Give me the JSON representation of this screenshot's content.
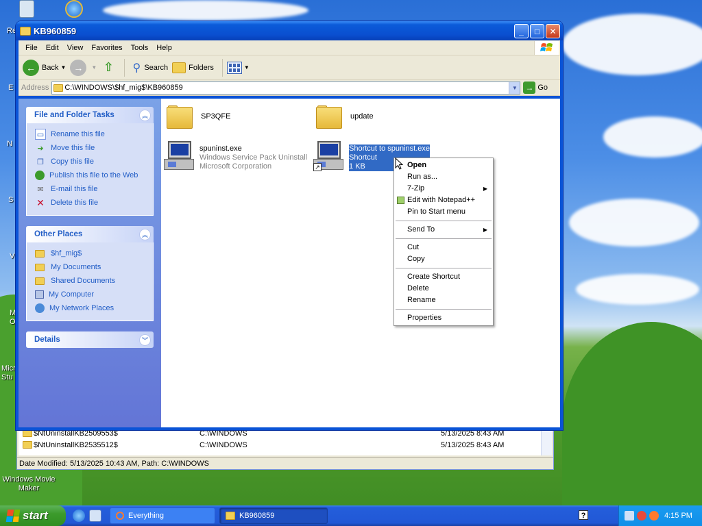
{
  "desktop": {
    "icons": [
      {
        "name": "recycle-bin-icon"
      },
      {
        "name": "internet-explorer-icon"
      }
    ],
    "fragments": [
      "Re",
      "E",
      "N",
      "S",
      "V",
      "M\nO",
      "Micro\nStu"
    ],
    "movie_maker_label": "Windows Movie Maker"
  },
  "window": {
    "title": "KB960859",
    "menu": [
      "File",
      "Edit",
      "View",
      "Favorites",
      "Tools",
      "Help"
    ],
    "toolbar": {
      "back": "Back",
      "search": "Search",
      "folders": "Folders"
    },
    "address": {
      "label": "Address",
      "value": "C:\\WINDOWS\\$hf_mig$\\KB960859",
      "go": "Go"
    },
    "tasks": {
      "file_folder": {
        "title": "File and Folder Tasks",
        "items": [
          "Rename this file",
          "Move this file",
          "Copy this file",
          "Publish this file to the Web",
          "E-mail this file",
          "Delete this file"
        ]
      },
      "other_places": {
        "title": "Other Places",
        "items": [
          "$hf_mig$",
          "My Documents",
          "Shared Documents",
          "My Computer",
          "My Network Places"
        ]
      },
      "details": {
        "title": "Details"
      }
    },
    "files": [
      {
        "name": "SP3QFE",
        "type": "folder"
      },
      {
        "name": "update",
        "type": "folder"
      },
      {
        "name": "spuninst.exe",
        "line2": "Windows Service Pack Uninstall",
        "line3": "Microsoft Corporation"
      },
      {
        "name": "Shortcut to spuninst.exe",
        "line2": "Shortcut",
        "line3": "1 KB"
      }
    ]
  },
  "context_menu": {
    "groups": [
      [
        {
          "label": "Open",
          "bold": true
        },
        {
          "label": "Run as..."
        },
        {
          "label": "7-Zip",
          "submenu": true
        },
        {
          "label": "Edit with Notepad++",
          "icon": "notepad-plus-plus-icon"
        },
        {
          "label": "Pin to Start menu"
        }
      ],
      [
        {
          "label": "Send To",
          "submenu": true
        }
      ],
      [
        {
          "label": "Cut"
        },
        {
          "label": "Copy"
        }
      ],
      [
        {
          "label": "Create Shortcut"
        },
        {
          "label": "Delete"
        },
        {
          "label": "Rename"
        }
      ],
      [
        {
          "label": "Properties"
        }
      ]
    ]
  },
  "background_window": {
    "rows": [
      {
        "name": "$NtUninstallKB2509553$",
        "path": "C:\\WINDOWS",
        "date": "5/13/2025 8:43 AM"
      },
      {
        "name": "$NtUninstallKB2535512$",
        "path": "C:\\WINDOWS",
        "date": "5/13/2025 8:43 AM"
      }
    ],
    "status": "Date Modified: 5/13/2025 10:43 AM, Path: C:\\WINDOWS"
  },
  "taskbar": {
    "start": "start",
    "buttons": [
      {
        "label": "Everything"
      },
      {
        "label": "KB960859"
      }
    ],
    "clock": "4:15 PM"
  },
  "colors": {
    "xp_blue": "#0a53d6",
    "selection": "#316ac5",
    "task_link": "#215dc6",
    "start_green": "#3c9b2c"
  }
}
